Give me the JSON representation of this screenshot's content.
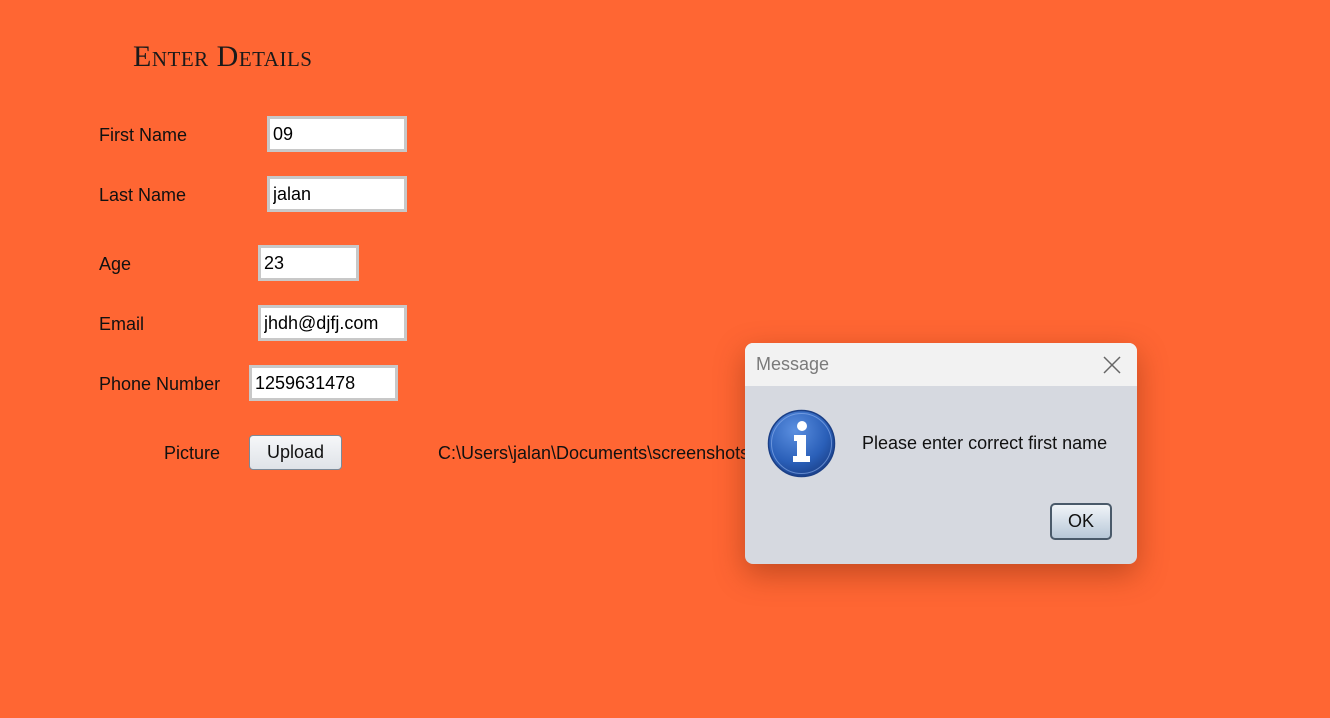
{
  "form": {
    "title": "Enter Details",
    "fields": {
      "first_name": {
        "label": "First Name",
        "value": "09"
      },
      "last_name": {
        "label": "Last Name",
        "value": "jalan"
      },
      "age": {
        "label": "Age",
        "value": "23"
      },
      "email": {
        "label": "Email",
        "value": "jhdh@djfj.com"
      },
      "phone": {
        "label": "Phone Number",
        "value": "1259631478"
      }
    },
    "picture": {
      "label": "Picture",
      "upload_label": "Upload",
      "path": "C:\\Users\\jalan\\Documents\\screenshots"
    }
  },
  "dialog": {
    "title": "Message",
    "message": "Please enter correct first name",
    "ok_label": "OK",
    "icon": "info-icon"
  },
  "colors": {
    "background": "#ff6633",
    "dialog_body": "#d6d9e0",
    "dialog_titlebar": "#f2f2f2",
    "info_icon": "#2a5fb8"
  }
}
